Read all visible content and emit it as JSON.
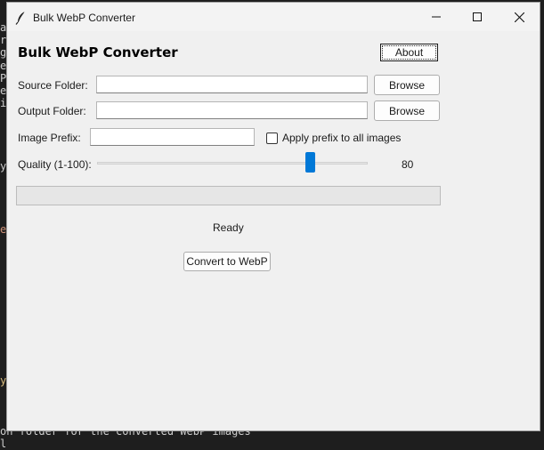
{
  "background": {
    "left_chars": [
      "a",
      "r",
      "g",
      "e",
      "P",
      "e",
      "i",
      "",
      "",
      "",
      "",
      "y",
      "",
      "",
      "",
      "",
      "e",
      "",
      "",
      "",
      "",
      "",
      "",
      "",
      "",
      "",
      "",
      "",
      "y",
      "",
      "",
      "",
      "",
      "l"
    ],
    "bottom_text": "on folder for the converted WebP images"
  },
  "window": {
    "title": "Bulk WebP Converter",
    "icon": "feather-icon",
    "controls": {
      "minimize": "minimize-icon",
      "maximize": "maximize-icon",
      "close": "close-icon"
    }
  },
  "app": {
    "heading": "Bulk WebP Converter",
    "about_label": "About",
    "source": {
      "label": "Source Folder:",
      "value": "",
      "browse_label": "Browse"
    },
    "output": {
      "label": "Output Folder:",
      "value": "",
      "browse_label": "Browse"
    },
    "prefix": {
      "label": "Image Prefix:",
      "value": "",
      "checkbox_label": "Apply prefix to all images",
      "checked": false
    },
    "quality": {
      "label": "Quality (1-100):",
      "min": 1,
      "max": 100,
      "value": 80,
      "value_text": "80"
    },
    "progress": {
      "value": 0
    },
    "status": "Ready",
    "convert_label": "Convert to WebP"
  },
  "colors": {
    "accent": "#0078d7",
    "window_bg": "#f0f0f0",
    "terminal_bg": "#1e1e1e"
  }
}
